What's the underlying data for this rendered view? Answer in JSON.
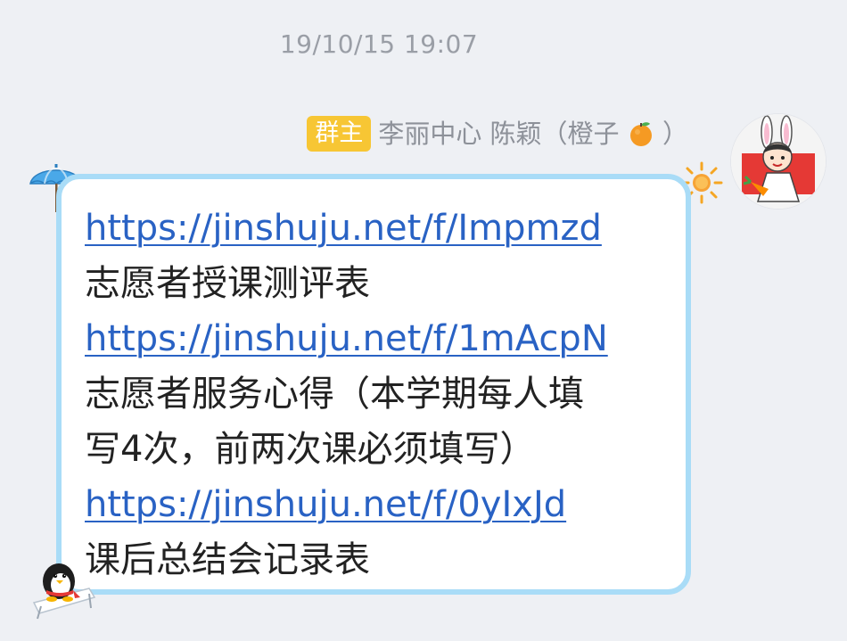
{
  "timestamp": "19/10/15 19:07",
  "sender": {
    "role_badge": "群主",
    "name_prefix": "李丽中心 陈颖（橙子",
    "name_suffix": "）",
    "emoji_icon": "orange-icon",
    "avatar_icon": "avatar-bunny-ears-icon"
  },
  "bubble": {
    "border_color": "#a9dcf7",
    "link_color": "#2962c4",
    "lines": [
      {
        "text": "https://jinshuju.net/f/Impmzd",
        "type": "link"
      },
      {
        "text": "志愿者授课测评表",
        "type": "text"
      },
      {
        "text": "https://jinshuju.net/f/1mAcpN",
        "type": "link"
      },
      {
        "text": "志愿者服务心得（本学期每人填",
        "type": "text"
      },
      {
        "text": "写4次，前两次课必须填写）",
        "type": "text"
      },
      {
        "text": "https://jinshuju.net/f/0yIxJd",
        "type": "link"
      },
      {
        "text": "课后总结会记录表",
        "type": "text"
      }
    ],
    "decorations": [
      "umbrella-icon",
      "sun-icon",
      "penguin-icon"
    ]
  }
}
